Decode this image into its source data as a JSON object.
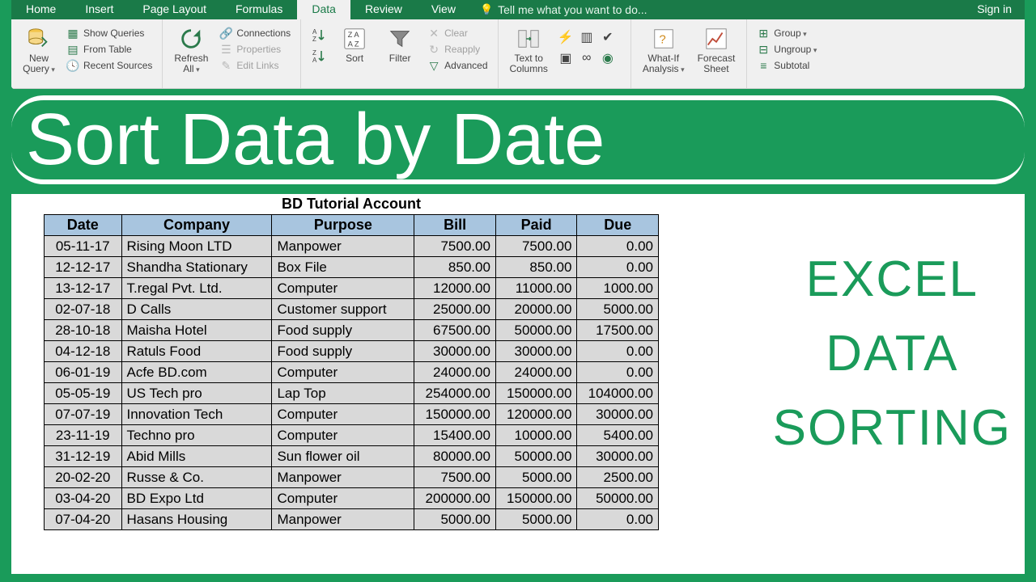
{
  "tabs": {
    "items": [
      "Home",
      "Insert",
      "Page Layout",
      "Formulas",
      "Data",
      "Review",
      "View"
    ],
    "active": "Data",
    "tellme": "Tell me what you want to do...",
    "signin": "Sign in"
  },
  "ribbon": {
    "newQuery": "New\nQuery",
    "showQueries": "Show Queries",
    "fromTable": "From Table",
    "recentSources": "Recent Sources",
    "refreshAll": "Refresh\nAll",
    "connections": "Connections",
    "properties": "Properties",
    "editLinks": "Edit Links",
    "sort": "Sort",
    "filter": "Filter",
    "clear": "Clear",
    "reapply": "Reapply",
    "advanced": "Advanced",
    "textToColumns": "Text to\nColumns",
    "whatIf": "What-If\nAnalysis",
    "forecastSheet": "Forecast\nSheet",
    "group": "Group",
    "ungroup": "Ungroup",
    "subtotal": "Subtotal"
  },
  "banner": "Sort Data by Date",
  "sideText": [
    "EXCEL",
    "DATA",
    "SORTING"
  ],
  "table": {
    "title": "BD Tutorial Account",
    "headers": [
      "Date",
      "Company",
      "Purpose",
      "Bill",
      "Paid",
      "Due"
    ],
    "rows": [
      {
        "date": "05-11-17",
        "company": "Rising Moon LTD",
        "purpose": "Manpower",
        "bill": "7500.00",
        "paid": "7500.00",
        "due": "0.00"
      },
      {
        "date": "12-12-17",
        "company": "Shandha Stationary",
        "purpose": "Box File",
        "bill": "850.00",
        "paid": "850.00",
        "due": "0.00"
      },
      {
        "date": "13-12-17",
        "company": "T.regal Pvt. Ltd.",
        "purpose": "Computer",
        "bill": "12000.00",
        "paid": "11000.00",
        "due": "1000.00"
      },
      {
        "date": "02-07-18",
        "company": "D Calls",
        "purpose": "Customer support",
        "bill": "25000.00",
        "paid": "20000.00",
        "due": "5000.00"
      },
      {
        "date": "28-10-18",
        "company": "Maisha Hotel",
        "purpose": "Food supply",
        "bill": "67500.00",
        "paid": "50000.00",
        "due": "17500.00"
      },
      {
        "date": "04-12-18",
        "company": "Ratuls Food",
        "purpose": "Food supply",
        "bill": "30000.00",
        "paid": "30000.00",
        "due": "0.00"
      },
      {
        "date": "06-01-19",
        "company": "Acfe BD.com",
        "purpose": "Computer",
        "bill": "24000.00",
        "paid": "24000.00",
        "due": "0.00"
      },
      {
        "date": "05-05-19",
        "company": "US Tech pro",
        "purpose": "Lap Top",
        "bill": "254000.00",
        "paid": "150000.00",
        "due": "104000.00"
      },
      {
        "date": "07-07-19",
        "company": "Innovation Tech",
        "purpose": "Computer",
        "bill": "150000.00",
        "paid": "120000.00",
        "due": "30000.00"
      },
      {
        "date": "23-11-19",
        "company": "Techno pro",
        "purpose": "Computer",
        "bill": "15400.00",
        "paid": "10000.00",
        "due": "5400.00"
      },
      {
        "date": "31-12-19",
        "company": "Abid Mills",
        "purpose": "Sun flower oil",
        "bill": "80000.00",
        "paid": "50000.00",
        "due": "30000.00"
      },
      {
        "date": "20-02-20",
        "company": "Russe & Co.",
        "purpose": "Manpower",
        "bill": "7500.00",
        "paid": "5000.00",
        "due": "2500.00"
      },
      {
        "date": "03-04-20",
        "company": "BD Expo Ltd",
        "purpose": "Computer",
        "bill": "200000.00",
        "paid": "150000.00",
        "due": "50000.00"
      },
      {
        "date": "07-04-20",
        "company": "Hasans Housing",
        "purpose": "Manpower",
        "bill": "5000.00",
        "paid": "5000.00",
        "due": "0.00"
      }
    ]
  }
}
